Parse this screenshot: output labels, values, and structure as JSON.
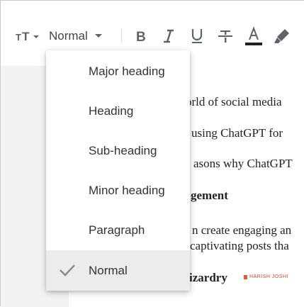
{
  "toolbar": {
    "text_style_icon": "text-size-icon",
    "style_select_value": "Normal",
    "buttons": [
      {
        "name": "bold",
        "icon": "bold-icon",
        "glyph": "B"
      },
      {
        "name": "italic",
        "icon": "italic-icon",
        "glyph": "I"
      },
      {
        "name": "underline",
        "icon": "underline-icon",
        "glyph": "U"
      },
      {
        "name": "strikethrough",
        "icon": "strikethrough-icon"
      },
      {
        "name": "text-color",
        "icon": "text-color-icon",
        "glyph": "A"
      },
      {
        "name": "highlight",
        "icon": "highlighter-icon"
      }
    ]
  },
  "menu": {
    "items": [
      {
        "label": "Major heading"
      },
      {
        "label": "Heading"
      },
      {
        "label": "Sub-heading"
      },
      {
        "label": "Minor heading"
      },
      {
        "label": "Paragraph"
      },
      {
        "label": "Normal",
        "selected": true
      }
    ],
    "selected_icon": "check-icon"
  },
  "document": {
    "lines": [
      "orld of social media",
      "using ChatGPT for",
      "asons why ChatGPT",
      "gement",
      "n create engaging an",
      "captivating posts tha",
      "izardry"
    ],
    "logo_text": "HARISH JOSHI"
  },
  "colors": {
    "icon_gray": "#5f6368",
    "text_color_underline": "#222222",
    "menu_selected_bg": "#ececec",
    "gutter_bg": "#f3f3f3"
  }
}
